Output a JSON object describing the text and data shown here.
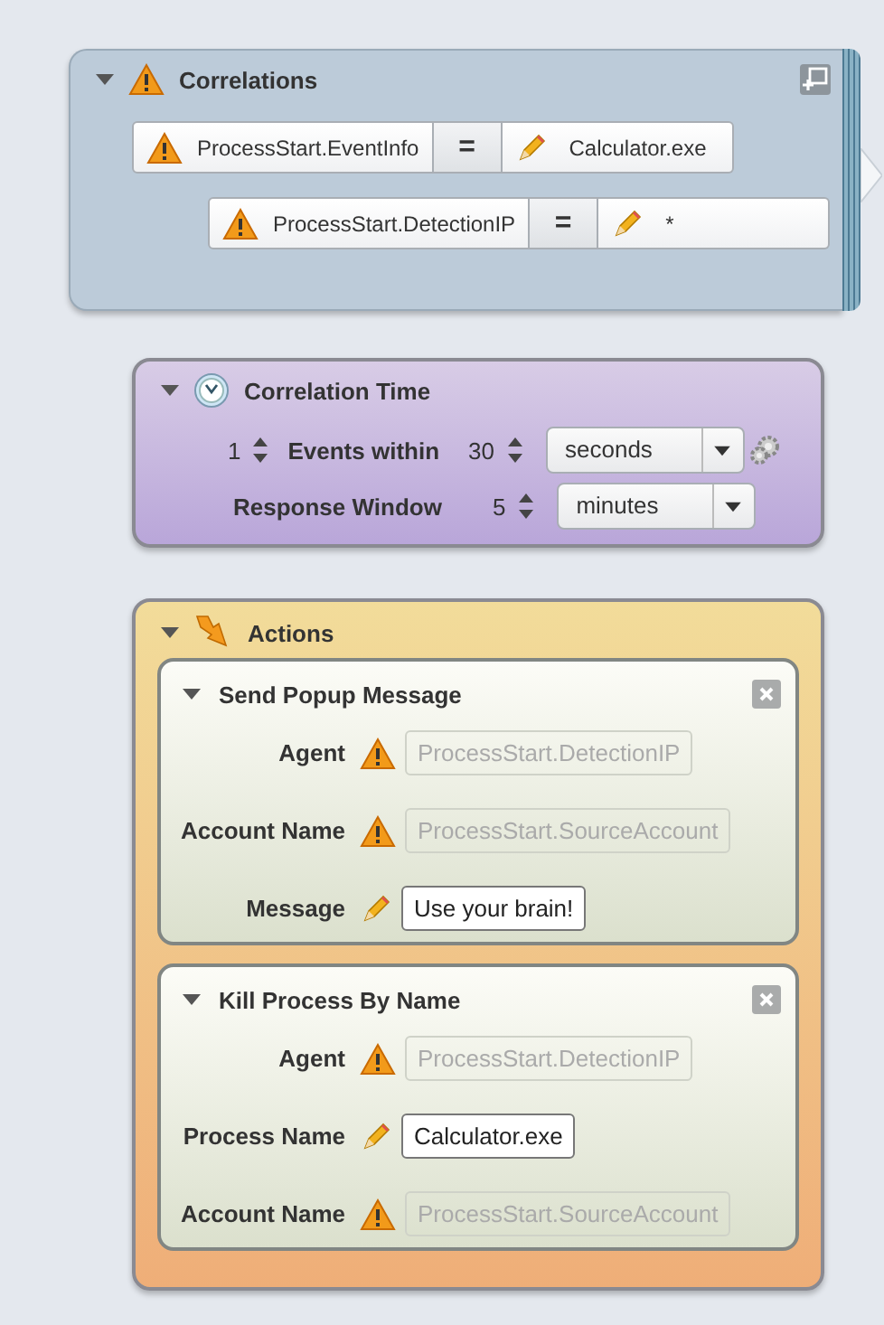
{
  "correlations": {
    "title": "Correlations",
    "expanded": true,
    "rows": [
      {
        "left": "ProcessStart.EventInfo",
        "operator": "=",
        "right": "Calculator.exe",
        "children": [
          {
            "left": "ProcessStart.DetectionIP",
            "operator": "=",
            "right": "*"
          }
        ]
      }
    ]
  },
  "correlation_time": {
    "title": "Correlation Time",
    "expanded": true,
    "count": "1",
    "count_label": "Events within",
    "within": "30",
    "within_unit": "seconds",
    "window_label": "Response Window",
    "window": "5",
    "window_unit": "minutes"
  },
  "actions": {
    "title": "Actions",
    "expanded": true,
    "items": [
      {
        "title": "Send Popup Message",
        "expanded": true,
        "fields": [
          {
            "label": "Agent",
            "kind": "variable",
            "value": "ProcessStart.DetectionIP"
          },
          {
            "label": "Account Name",
            "kind": "variable",
            "value": "ProcessStart.SourceAccount"
          },
          {
            "label": "Message",
            "kind": "literal",
            "value": "Use your brain!"
          }
        ]
      },
      {
        "title": "Kill Process By Name",
        "expanded": true,
        "fields": [
          {
            "label": "Agent",
            "kind": "variable",
            "value": "ProcessStart.DetectionIP"
          },
          {
            "label": "Process Name",
            "kind": "literal",
            "value": "Calculator.exe"
          },
          {
            "label": "Account Name",
            "kind": "variable",
            "value": "ProcessStart.SourceAccount"
          }
        ]
      }
    ]
  }
}
